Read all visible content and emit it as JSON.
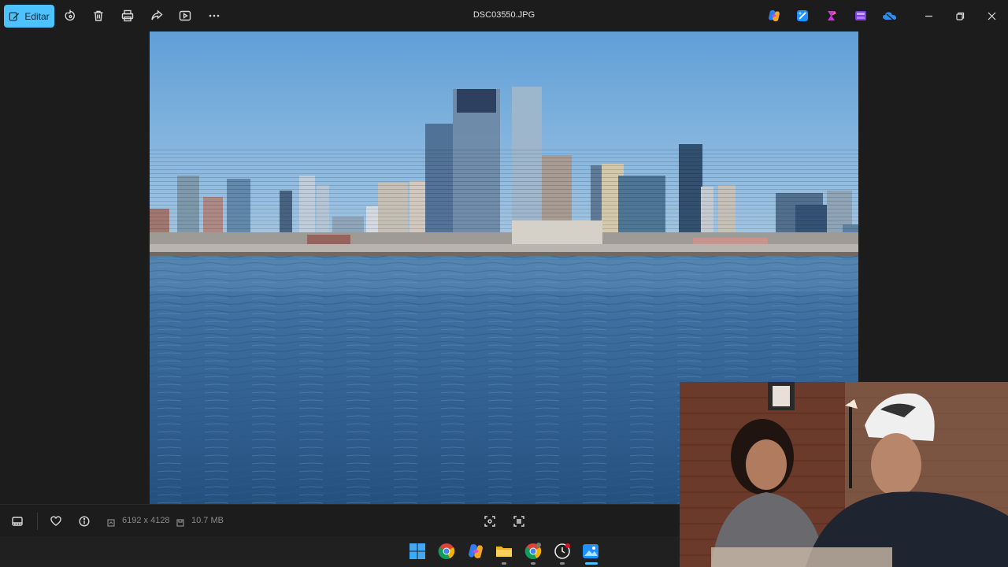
{
  "titlebar": {
    "edit_label": "Editar",
    "file_name": "DSC03550.JPG",
    "tool_icons": [
      "rotate-icon",
      "delete-icon",
      "print-icon",
      "share-icon",
      "slideshow-icon",
      "more-icon"
    ],
    "app_icons": [
      "copilot-icon",
      "designer-icon",
      "clipchamp-icon",
      "clipchamp-video-icon",
      "onedrive-icon"
    ],
    "window_controls": [
      "minimize-icon",
      "restore-icon",
      "close-icon"
    ]
  },
  "statusbar": {
    "dimensions": "6192 x 4128",
    "file_size": "10.7 MB",
    "left_icons": [
      "filmstrip-icon",
      "favorite-icon",
      "info-icon"
    ],
    "center_icons": [
      "fit-to-window-icon",
      "actual-size-icon"
    ]
  },
  "taskbar": {
    "items": [
      "start-icon",
      "chrome-icon",
      "copilot-icon",
      "file-explorer-icon",
      "chrome-alt-icon",
      "clock-app-icon",
      "photos-icon"
    ]
  },
  "colors": {
    "accent": "#4cc2ff",
    "background": "#1c1c1c",
    "taskbar": "#202020"
  }
}
